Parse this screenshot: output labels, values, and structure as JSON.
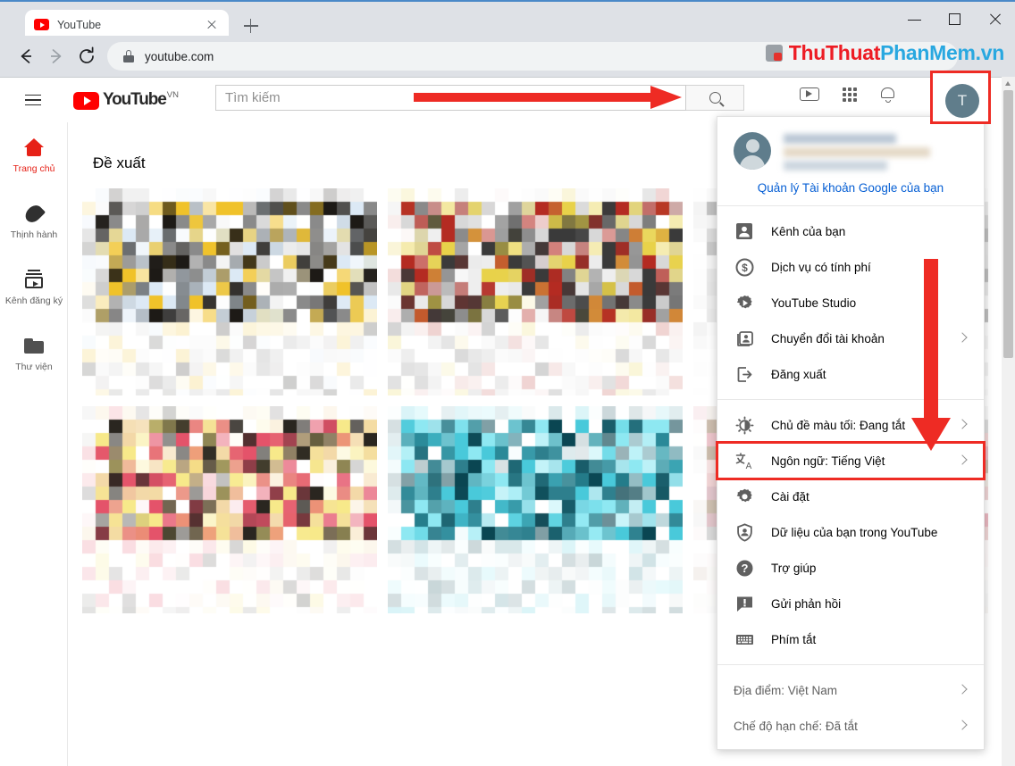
{
  "browser": {
    "tab_title": "YouTube",
    "tab_favicon": "youtube-icon",
    "new_tab_label": "+",
    "url": "youtube.com",
    "lock_icon": "lock-icon",
    "back_icon": "arrow-back-icon",
    "forward_icon": "arrow-forward-icon",
    "reload_icon": "reload-icon",
    "window_minimize": "minimize-icon",
    "window_maximize": "maximize-icon",
    "window_close": "close-icon"
  },
  "watermark": {
    "part1": "ThuThuat",
    "part2": "PhanMem",
    "part3": ".vn",
    "color1": "#ed1c24",
    "color2": "#29a8e0"
  },
  "header": {
    "menu_icon": "hamburger-menu-icon",
    "logo_text": "YouTube",
    "logo_country": "VN",
    "search_placeholder": "Tìm kiếm",
    "search_value": "",
    "search_button_icon": "search-icon",
    "create_icon": "video-camera-icon",
    "apps_icon": "apps-grid-icon",
    "notifications_icon": "bell-icon",
    "avatar_initial": "T"
  },
  "sidebar": {
    "items": [
      {
        "label": "Trang chủ",
        "icon": "home-icon",
        "active": true
      },
      {
        "label": "Thịnh hành",
        "icon": "trending-fire-icon",
        "active": false
      },
      {
        "label": "Kênh đăng ký",
        "icon": "subscriptions-icon",
        "active": false
      },
      {
        "label": "Thư viện",
        "icon": "library-folder-icon",
        "active": false
      }
    ]
  },
  "main": {
    "section_title": "Đề xuất",
    "thumbnails": [
      {
        "name": "video-thumbnail-1",
        "palette": [
          "#dce9f5",
          "#f0c22a",
          "#1d1a16",
          "#8a8a8a",
          "#ffffff"
        ]
      },
      {
        "name": "video-thumbnail-2",
        "palette": [
          "#d8d8d8",
          "#b42b22",
          "#3a3a3a",
          "#e8d24a",
          "#ffffff"
        ]
      },
      {
        "name": "video-thumbnail-3",
        "palette": [
          "#e2e2e2",
          "#c9c9c9",
          "#f2f2f2",
          "#bdbdbd",
          "#ffffff"
        ]
      },
      {
        "name": "video-thumbnail-4",
        "palette": [
          "#f7e98a",
          "#e4536a",
          "#2a2620",
          "#f3d9a8",
          "#ffffff"
        ]
      },
      {
        "name": "video-thumbnail-5",
        "palette": [
          "#0a4652",
          "#49c9da",
          "#8ee8f2",
          "#2e7f8d",
          "#ffffff"
        ]
      },
      {
        "name": "video-thumbnail-6",
        "palette": [
          "#e8b6c0",
          "#f0d6d6",
          "#d8d8d8",
          "#c8b8a8",
          "#ffffff"
        ]
      }
    ]
  },
  "account_menu": {
    "account_name_blurred": true,
    "manage_account_label": "Quản lý Tài khoản Google của bạn",
    "groups": [
      {
        "name": "account-group",
        "items": [
          {
            "label": "Kênh của bạn",
            "icon": "person-badge-icon",
            "chevron": false
          },
          {
            "label": "Dịch vụ có tính phí",
            "icon": "dollar-circle-icon",
            "chevron": false
          },
          {
            "label": "YouTube Studio",
            "icon": "studio-gear-icon",
            "chevron": false
          },
          {
            "label": "Chuyển đổi tài khoản",
            "icon": "switch-account-icon",
            "chevron": true
          },
          {
            "label": "Đăng xuất",
            "icon": "sign-out-icon",
            "chevron": false
          }
        ]
      },
      {
        "name": "settings-group",
        "items": [
          {
            "label": "Chủ đề màu tối: Đang tắt",
            "icon": "dark-theme-icon",
            "chevron": true,
            "highlight": false
          },
          {
            "label": "Ngôn ngữ: Tiếng Việt",
            "icon": "language-icon",
            "chevron": true,
            "highlight": true
          },
          {
            "label": "Cài đặt",
            "icon": "settings-gear-icon",
            "chevron": false,
            "highlight": false
          },
          {
            "label": "Dữ liệu của bạn trong YouTube",
            "icon": "shield-person-icon",
            "chevron": false,
            "highlight": false
          },
          {
            "label": "Trợ giúp",
            "icon": "help-circle-icon",
            "chevron": false,
            "highlight": false
          },
          {
            "label": "Gửi phản hồi",
            "icon": "feedback-icon",
            "chevron": false,
            "highlight": false
          },
          {
            "label": "Phím tắt",
            "icon": "keyboard-icon",
            "chevron": false,
            "highlight": false
          }
        ]
      },
      {
        "name": "locale-group",
        "items": [
          {
            "label": "Địa điểm: Việt Nam",
            "icon": "",
            "chevron": true,
            "muted": true
          },
          {
            "label": "Chế độ hạn chế: Đã tắt",
            "icon": "",
            "chevron": true,
            "muted": true
          }
        ]
      }
    ]
  },
  "annotations": {
    "arrow_color": "#ee2b24",
    "horizontal_arrow": "points-right-to-avatar",
    "vertical_arrow": "points-down-to-language-item",
    "highlight_avatar": "avatar-button",
    "highlight_menu_item": "Ngôn ngữ: Tiếng Việt"
  }
}
